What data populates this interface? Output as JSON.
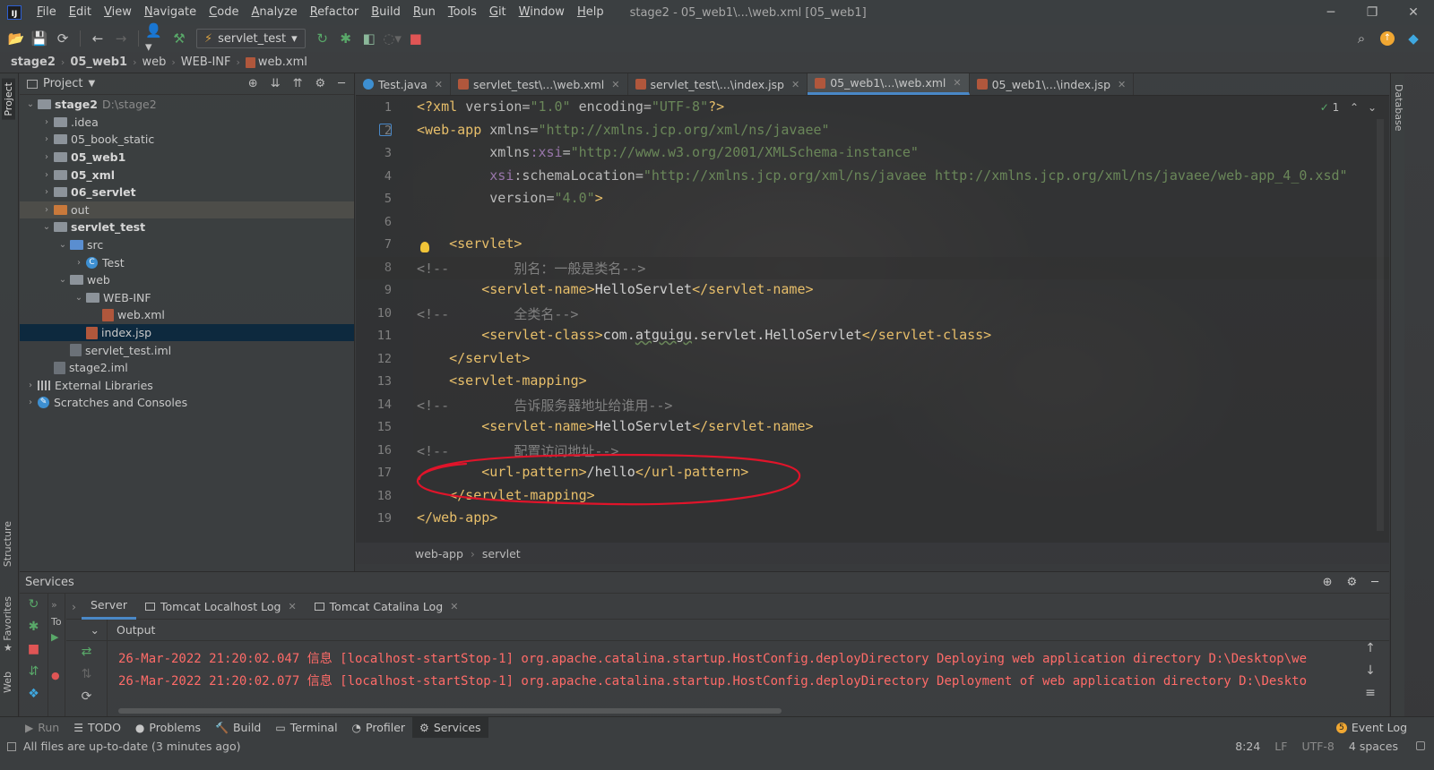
{
  "window": {
    "title": "stage2 - 05_web1\\...\\web.xml [05_web1]",
    "controls": {
      "minimize": "─",
      "restore": "❐",
      "close": "✕"
    }
  },
  "menu": [
    "File",
    "Edit",
    "View",
    "Navigate",
    "Code",
    "Analyze",
    "Refactor",
    "Build",
    "Run",
    "Tools",
    "Git",
    "Window",
    "Help"
  ],
  "toolbar": {
    "run_config": "servlet_test"
  },
  "breadcrumb": [
    "stage2",
    "05_web1",
    "web",
    "WEB-INF",
    "web.xml"
  ],
  "left_stripe": {
    "project": "Project",
    "structure": "Structure",
    "favorites": "Favorites",
    "web": "Web"
  },
  "right_stripe": {
    "database": "Database"
  },
  "project_panel": {
    "title": "Project",
    "tree": [
      {
        "label": "stage2",
        "sub": "D:\\stage2",
        "depth": 0,
        "expanded": true,
        "kind": "folder",
        "bold": true
      },
      {
        "label": ".idea",
        "depth": 1,
        "expanded": false,
        "kind": "folder"
      },
      {
        "label": "05_book_static",
        "depth": 1,
        "expanded": false,
        "kind": "folder"
      },
      {
        "label": "05_web1",
        "depth": 1,
        "expanded": false,
        "kind": "folder",
        "bold": true
      },
      {
        "label": "05_xml",
        "depth": 1,
        "expanded": false,
        "kind": "folder",
        "bold": true
      },
      {
        "label": "06_servlet",
        "depth": 1,
        "expanded": false,
        "kind": "folder",
        "bold": true
      },
      {
        "label": "out",
        "depth": 1,
        "expanded": false,
        "kind": "folder-orange",
        "light": true
      },
      {
        "label": "servlet_test",
        "depth": 1,
        "expanded": true,
        "kind": "folder",
        "bold": true
      },
      {
        "label": "src",
        "depth": 2,
        "expanded": true,
        "kind": "folder-blue"
      },
      {
        "label": "Test",
        "depth": 3,
        "expanded": false,
        "kind": "class"
      },
      {
        "label": "web",
        "depth": 2,
        "expanded": true,
        "kind": "folder"
      },
      {
        "label": "WEB-INF",
        "depth": 3,
        "expanded": true,
        "kind": "folder"
      },
      {
        "label": "web.xml",
        "depth": 4,
        "kind": "xml"
      },
      {
        "label": "index.jsp",
        "depth": 3,
        "kind": "jsp",
        "selected": true
      },
      {
        "label": "servlet_test.iml",
        "depth": 2,
        "kind": "iml"
      },
      {
        "label": "stage2.iml",
        "depth": 1,
        "kind": "iml"
      },
      {
        "label": "External Libraries",
        "depth": 0,
        "expanded": false,
        "kind": "lib"
      },
      {
        "label": "Scratches and Consoles",
        "depth": 0,
        "expanded": false,
        "kind": "scratch"
      }
    ]
  },
  "editor_tabs": [
    {
      "label": "Test.java",
      "icon": "java"
    },
    {
      "label": "servlet_test\\...\\web.xml",
      "icon": "xml"
    },
    {
      "label": "servlet_test\\...\\index.jsp",
      "icon": "jsp"
    },
    {
      "label": "05_web1\\...\\web.xml",
      "icon": "xml",
      "active": true
    },
    {
      "label": "05_web1\\...\\index.jsp",
      "icon": "jsp"
    }
  ],
  "editor": {
    "current_line": 8,
    "inspection_count": "1",
    "lines": [
      [
        [
          "t-tag",
          "<?xml "
        ],
        [
          "t-attr",
          "version="
        ],
        [
          "t-val",
          "\"1.0\""
        ],
        [
          "t-attr",
          " encoding="
        ],
        [
          "t-val",
          "\"UTF-8\""
        ],
        [
          "t-tag",
          "?>"
        ]
      ],
      [
        [
          "t-tag",
          "<web-app "
        ],
        [
          "t-attr",
          "xmlns="
        ],
        [
          "t-val",
          "\"http://xmlns.jcp.org/xml/ns/javaee\""
        ]
      ],
      [
        [
          "t-attr",
          "         xmlns"
        ],
        [
          "t-ns",
          ":xsi"
        ],
        [
          "t-attr",
          "="
        ],
        [
          "t-val",
          "\"http://www.w3.org/2001/XMLSchema-instance\""
        ]
      ],
      [
        [
          "t-ns",
          "         xsi"
        ],
        [
          "t-attr",
          ":schemaLocation="
        ],
        [
          "t-val",
          "\"http://xmlns.jcp.org/xml/ns/javaee http://xmlns.jcp.org/xml/ns/javaee/web-app_4_0.xsd\""
        ]
      ],
      [
        [
          "t-attr",
          "         version="
        ],
        [
          "t-val",
          "\"4.0\""
        ],
        [
          "t-tag",
          ">"
        ]
      ],
      [],
      [
        [
          "t-tag",
          "    <servlet>"
        ]
      ],
      [
        [
          "t-cmt",
          "<!--        别名：一般是类名-->"
        ]
      ],
      [
        [
          "t-tag",
          "        <servlet-name>"
        ],
        [
          "t-txt",
          "HelloServlet"
        ],
        [
          "t-tag",
          "</servlet-name>"
        ]
      ],
      [
        [
          "t-cmt",
          "<!--        全类名-->"
        ]
      ],
      [
        [
          "t-tag",
          "        <servlet-class>"
        ],
        [
          "t-txt",
          "com."
        ],
        [
          "t-txt t-under",
          "atguigu"
        ],
        [
          "t-txt",
          ".servlet.HelloServlet"
        ],
        [
          "t-tag",
          "</servlet-class>"
        ]
      ],
      [
        [
          "t-tag",
          "    </servlet>"
        ]
      ],
      [
        [
          "t-tag",
          "    <servlet-mapping>"
        ]
      ],
      [
        [
          "t-cmt",
          "<!--        告诉服务器地址给谁用-->"
        ]
      ],
      [
        [
          "t-tag",
          "        <servlet-name>"
        ],
        [
          "t-txt",
          "HelloServlet"
        ],
        [
          "t-tag",
          "</servlet-name>"
        ]
      ],
      [
        [
          "t-cmt",
          "<!--        配置访问地址-->"
        ]
      ],
      [
        [
          "t-tag",
          "        <url-pattern>"
        ],
        [
          "t-txt",
          "/hello"
        ],
        [
          "t-tag",
          "</url-pattern>"
        ]
      ],
      [
        [
          "t-tag",
          "    </servlet-mapping>"
        ]
      ],
      [
        [
          "t-tag",
          "</web-app>"
        ]
      ]
    ]
  },
  "editor_breadcrumb": [
    "web-app",
    "servlet"
  ],
  "services": {
    "title": "Services",
    "tree_stub": "To",
    "tabs": [
      {
        "label": "Server",
        "active": true
      },
      {
        "label": "Tomcat Localhost Log",
        "closable": true
      },
      {
        "label": "Tomcat Catalina Log",
        "closable": true
      }
    ],
    "output_label": "Output",
    "log_lines": [
      "26-Mar-2022 21:20:02.047 信息 [localhost-startStop-1] org.apache.catalina.startup.HostConfig.deployDirectory Deploying web application directory D:\\Desktop\\we",
      "26-Mar-2022 21:20:02.077 信息 [localhost-startStop-1] org.apache.catalina.startup.HostConfig.deployDirectory Deployment of web application directory D:\\Deskto"
    ]
  },
  "tool_windows": [
    {
      "label": "Run",
      "icon": "▶",
      "dim": true
    },
    {
      "label": "TODO",
      "icon": "☰"
    },
    {
      "label": "Problems",
      "icon": "●"
    },
    {
      "label": "Build",
      "icon": "🔨"
    },
    {
      "label": "Terminal",
      "icon": "▭"
    },
    {
      "label": "Profiler",
      "icon": "◔"
    },
    {
      "label": "Services",
      "icon": "⚙",
      "active": true
    }
  ],
  "event_log": {
    "label": "Event Log",
    "count": "5"
  },
  "status": {
    "message": "All files are up-to-date (3 minutes ago)",
    "position": "8:24",
    "line_sep": "LF",
    "encoding": "UTF-8",
    "indent": "4 spaces"
  },
  "colors": {
    "annotation": "#e0142a",
    "selection": "#0d293e",
    "log_error": "#ff6b68",
    "accent": "#4a88c7"
  }
}
